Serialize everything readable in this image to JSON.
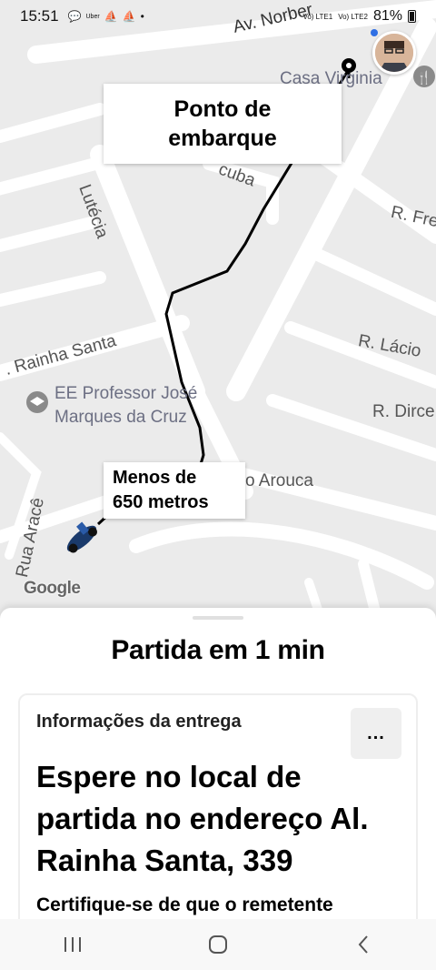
{
  "status_bar": {
    "time": "15:51",
    "notification_icons": [
      "chat-bubble-icon",
      "uber-icon",
      "boat-icon",
      "boat-icon",
      "dot-icon"
    ],
    "uber_label": "Uber",
    "sim1": "Vo) LTE1",
    "sim2": "Vo) LTE2",
    "battery": "81%"
  },
  "map": {
    "streets": {
      "av_norberto": "Av. Norber",
      "lutecia": "Lutécia",
      "rainha_santa": ". Rainha Santa",
      "r_fre": "R. Fre",
      "r_lacio": "R. Lácio",
      "r_dirce": "R. Dirce",
      "arouca": "o Arouca",
      "rua_arace": "Rua Aracê",
      "cuba": "cuba"
    },
    "poi_school": "EE Professor José\nMarques da Cruz",
    "poi_restaurant": "Casa Virginia",
    "pickup_callout": "Ponto de\nembarque",
    "distance_callout": "Menos de\n650 metros",
    "logo": "Google",
    "colors": {
      "road": "#ffffff",
      "background": "#ebebeb",
      "route": "#000000"
    }
  },
  "sheet": {
    "departure": "Partida em 1 min",
    "card": {
      "heading": "Informações da entrega",
      "more_button": "...",
      "instruction": "Espere no local de partida no endereço Al. Rainha Santa, 339",
      "note": "Certifique-se de que o remetente"
    }
  },
  "nav_bar": {
    "recents_icon": "recent-apps-icon",
    "home_icon": "home-icon",
    "back_icon": "back-icon"
  }
}
